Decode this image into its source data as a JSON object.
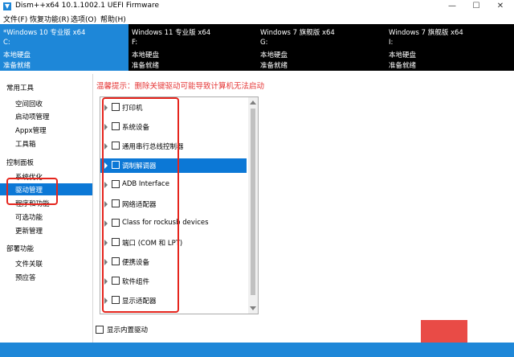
{
  "window": {
    "title": "Dism++x64 10.1.1002.1 UEFI Firmware",
    "controls": {
      "minimize": "—",
      "maximize": "☐",
      "close": "✕"
    },
    "accent": "#1e87d8",
    "warning_color": "#e53535"
  },
  "menu": [
    "文件(F)",
    "恢复功能(R)",
    "选项(O)",
    "帮助(H)"
  ],
  "systems": [
    {
      "name": "*Windows 10 专业版 x64",
      "drive": "C:",
      "type": "本地硬盘",
      "status": "准备就绪"
    },
    {
      "name": "Windows 11 专业版 x64",
      "drive": "F:",
      "type": "本地硬盘",
      "status": "准备就绪"
    },
    {
      "name": "Windows 7 旗舰版 x64",
      "drive": "G:",
      "type": "本地硬盘",
      "status": "准备就绪"
    },
    {
      "name": "Windows 7 旗舰版 x64",
      "drive": "I:",
      "type": "本地硬盘",
      "status": "准备就绪"
    }
  ],
  "sidebar": {
    "groups": [
      {
        "title": "常用工具",
        "items": [
          "空间回收",
          "启动项管理",
          "Appx管理",
          "工具箱"
        ]
      },
      {
        "title": "控制面板",
        "items": [
          "系统优化",
          "驱动管理",
          "程序和功能",
          "可选功能",
          "更新管理"
        ]
      },
      {
        "title": "部署功能",
        "items": [
          "文件关联",
          "预应答"
        ]
      }
    ],
    "selected": "驱动管理"
  },
  "main": {
    "warning": "温馨提示：删除关键驱动可能导致计算机无法启动",
    "drivers": [
      "打印机",
      "系统设备",
      "通用串行总线控制器",
      "调制解调器",
      "ADB Interface",
      "网络适配器",
      "Class for rockusb devices",
      "端口 (COM 和 LPT)",
      "便携设备",
      "软件组件",
      "显示适配器"
    ],
    "selected_driver": "调制解调器",
    "show_builtin_label": "显示内置驱动"
  }
}
